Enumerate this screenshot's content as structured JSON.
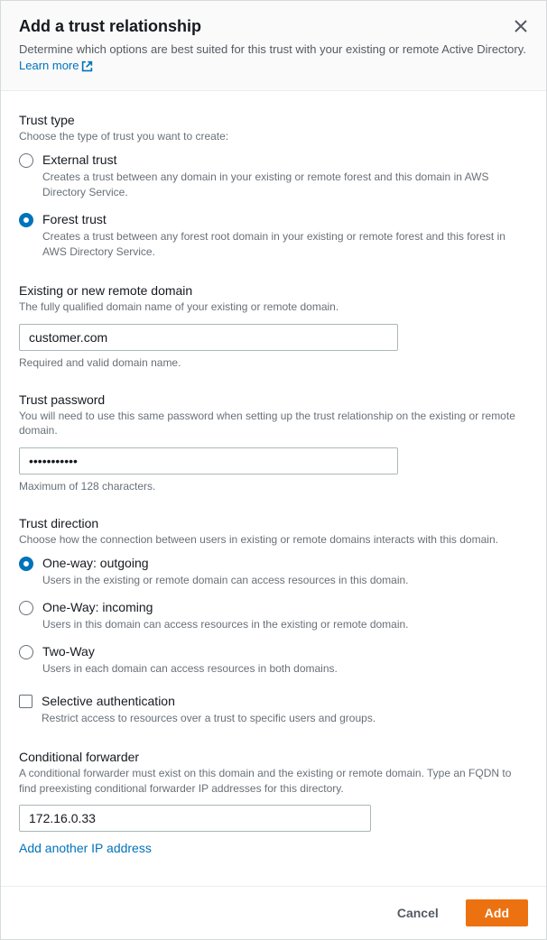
{
  "header": {
    "title": "Add a trust relationship",
    "subtitle": "Determine which options are best suited for this trust with your existing or remote Active Directory.",
    "learn_more": "Learn more"
  },
  "trust_type": {
    "title": "Trust type",
    "desc": "Choose the type of trust you want to create:",
    "options": [
      {
        "label": "External trust",
        "desc": "Creates a trust between any domain in your existing or remote forest and this domain in AWS Directory Service."
      },
      {
        "label": "Forest trust",
        "desc": "Creates a trust between any forest root domain in your existing or remote forest and this forest in AWS Directory Service."
      }
    ],
    "selected": 1
  },
  "remote_domain": {
    "title": "Existing or new remote domain",
    "desc": "The fully qualified domain name of your existing or remote domain.",
    "value": "customer.com",
    "hint": "Required and valid domain name."
  },
  "trust_password": {
    "title": "Trust password",
    "desc": "You will need to use this same password when setting up the trust relationship on the existing or remote domain.",
    "value": "•••••••••••",
    "hint": "Maximum of 128 characters."
  },
  "trust_direction": {
    "title": "Trust direction",
    "desc": "Choose how the connection between users in existing or remote domains interacts with this domain.",
    "options": [
      {
        "label": "One-way: outgoing",
        "desc": "Users in the existing or remote domain can access resources in this domain."
      },
      {
        "label": "One-Way: incoming",
        "desc": "Users in this domain can access resources in the existing or remote domain."
      },
      {
        "label": "Two-Way",
        "desc": "Users in each domain can access resources in both domains."
      }
    ],
    "selected": 0
  },
  "selective_auth": {
    "label": "Selective authentication",
    "desc": "Restrict access to resources over a trust to specific users and groups."
  },
  "conditional_forwarder": {
    "title": "Conditional forwarder",
    "desc": "A conditional forwarder must exist on this domain and the existing or remote domain. Type an FQDN to find preexisting conditional forwarder IP addresses for this directory.",
    "value": "172.16.0.33",
    "add_link": "Add another IP address"
  },
  "footer": {
    "cancel": "Cancel",
    "add": "Add"
  }
}
